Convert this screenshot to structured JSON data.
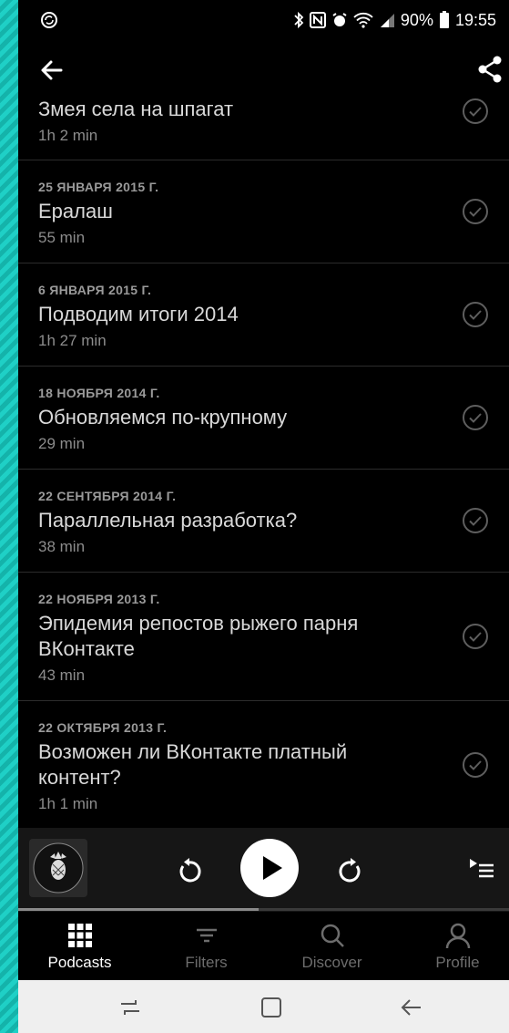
{
  "status_bar": {
    "battery_percent": "90%",
    "time": "19:55"
  },
  "episodes": [
    {
      "date": "",
      "title": "Змея села на шпагат",
      "duration": "1h 2 min"
    },
    {
      "date": "25 ЯНВАРЯ 2015 Г.",
      "title": "Ералаш",
      "duration": "55 min"
    },
    {
      "date": "6 ЯНВАРЯ 2015 Г.",
      "title": "Подводим итоги 2014",
      "duration": "1h 27 min"
    },
    {
      "date": "18 НОЯБРЯ 2014 Г.",
      "title": "Обновляемся по-крупному",
      "duration": "29 min"
    },
    {
      "date": "22 СЕНТЯБРЯ 2014 Г.",
      "title": "Параллельная разработка?",
      "duration": "38 min"
    },
    {
      "date": "22 НОЯБРЯ 2013 Г.",
      "title": "Эпидемия репостов рыжего парня ВКонтакте",
      "duration": "43 min"
    },
    {
      "date": "22 ОКТЯБРЯ 2013 Г.",
      "title": "Возможен ли ВКонтакте платный контент?",
      "duration": "1h 1 min"
    }
  ],
  "player": {
    "artwork_text": "СЕЗОН 2 подкаст Яблочко",
    "progress_fraction": 0.49
  },
  "tabs": [
    {
      "label": "Podcasts",
      "icon": "grid-icon",
      "active": true
    },
    {
      "label": "Filters",
      "icon": "filter-icon",
      "active": false
    },
    {
      "label": "Discover",
      "icon": "search-icon",
      "active": false
    },
    {
      "label": "Profile",
      "icon": "person-icon",
      "active": false
    }
  ],
  "colors": {
    "background": "#000000",
    "accent_teal": "#1fd0c6"
  }
}
